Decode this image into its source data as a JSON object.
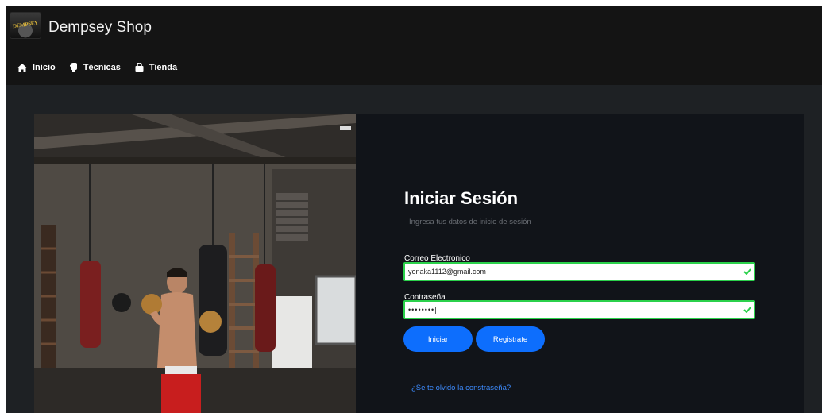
{
  "header": {
    "brand": "Dempsey Shop",
    "logo_text": "DEMPSEY",
    "nav": [
      {
        "label": "Inicio",
        "icon": "home-icon"
      },
      {
        "label": "Técnicas",
        "icon": "glove-icon"
      },
      {
        "label": "Tienda",
        "icon": "shopping-bag-icon"
      }
    ]
  },
  "login": {
    "title": "Iniciar Sesión",
    "subtitle": "Ingresa tus datos de inicio de sesión",
    "email_label": "Correo Electronico",
    "email_value": "yonaka1112@gmail.com",
    "password_label": "Contraseña",
    "password_value": "••••••••|",
    "login_button": "Iniciar",
    "register_button": "Registrate",
    "forgot_link": "¿Se te olvido la constraseña?"
  },
  "colors": {
    "header_bg": "#141414",
    "page_bg": "#1e2124",
    "panel_bg": "#111419",
    "accent": "#0d6efd",
    "valid": "#2bd14b"
  }
}
